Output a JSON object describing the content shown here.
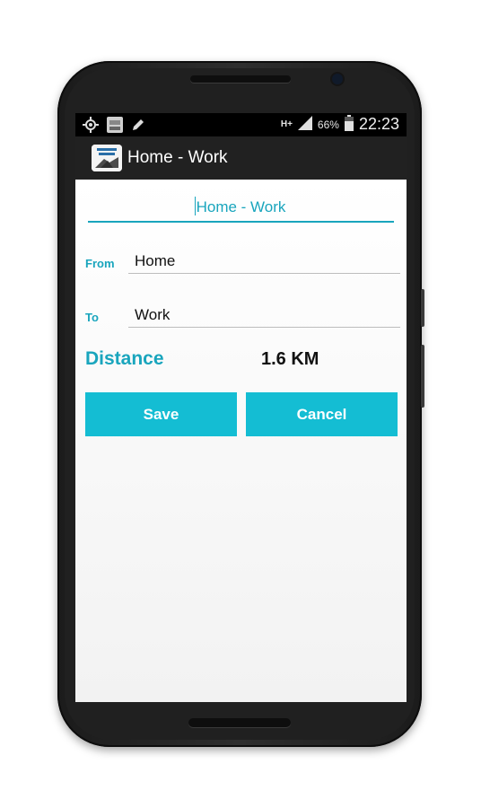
{
  "status_bar": {
    "icons_left": [
      "location-icon",
      "gallery-notification-icon",
      "edit-notification-icon"
    ],
    "network": "H+",
    "battery": "66%",
    "time": "22:23"
  },
  "action_bar": {
    "title": "Home - Work",
    "app_icon": "travel-distance-logo"
  },
  "form": {
    "route_name": "Home - Work",
    "from_label": "From",
    "from_value": "Home",
    "to_label": "To",
    "to_value": "Work"
  },
  "distance": {
    "label": "Distance",
    "value": "1.6 KM"
  },
  "buttons": {
    "save": "Save",
    "cancel": "Cancel"
  },
  "colors": {
    "accent": "#19a5bd",
    "button": "#14bdd3",
    "action_bar": "#212121"
  }
}
